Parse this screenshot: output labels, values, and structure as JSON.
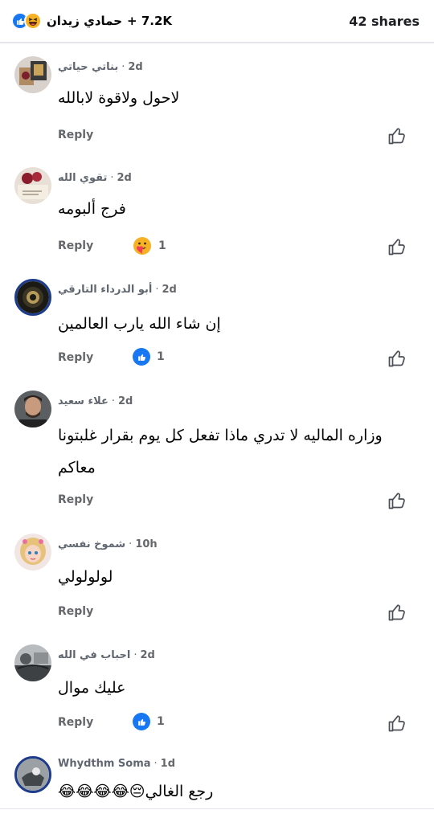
{
  "post": {
    "reaction_icons": [
      "like-icon",
      "haha-icon"
    ],
    "reacted_name": "حمادي زيدان",
    "reaction_count": "+ 7.2K",
    "shares": "42 shares"
  },
  "ui": {
    "reply_label": "Reply",
    "dot": "·"
  },
  "colors": {
    "like_blue": "#1877f2",
    "haha_yellow": "#f7b125",
    "meta_gray": "#65676b"
  },
  "comments": [
    {
      "name": "بناتي حياتي",
      "time": "2d",
      "text": "لاحول ولاقوة لابالله"
    },
    {
      "name": "تقوي الله",
      "time": "2d",
      "text": "فرج ألبومه",
      "reaction_icon": "care-icon",
      "reaction_count": "1"
    },
    {
      "name": "أبو الدرداء التارقي",
      "time": "2d",
      "text": "إن شاء الله يارب العالمين",
      "reaction_icon": "like-icon",
      "reaction_count": "1"
    },
    {
      "name": "علاء سعيد",
      "time": "2d",
      "text_line1": "وزاره الماليه لا تدري ماذا تفعل كل يوم بقرار غلبتونا",
      "text_line2": "معاكم"
    },
    {
      "name": "شموخ نفسي",
      "time": "10h",
      "text": "لولولولي"
    },
    {
      "name": "احباب في الله",
      "time": "2d",
      "text": "عليك موال",
      "reaction_icon": "like-icon",
      "reaction_count": "1"
    },
    {
      "name": "Whydthm Soma",
      "time": "1d",
      "text": "رجع الغالي😔😂😂😂😂"
    }
  ]
}
